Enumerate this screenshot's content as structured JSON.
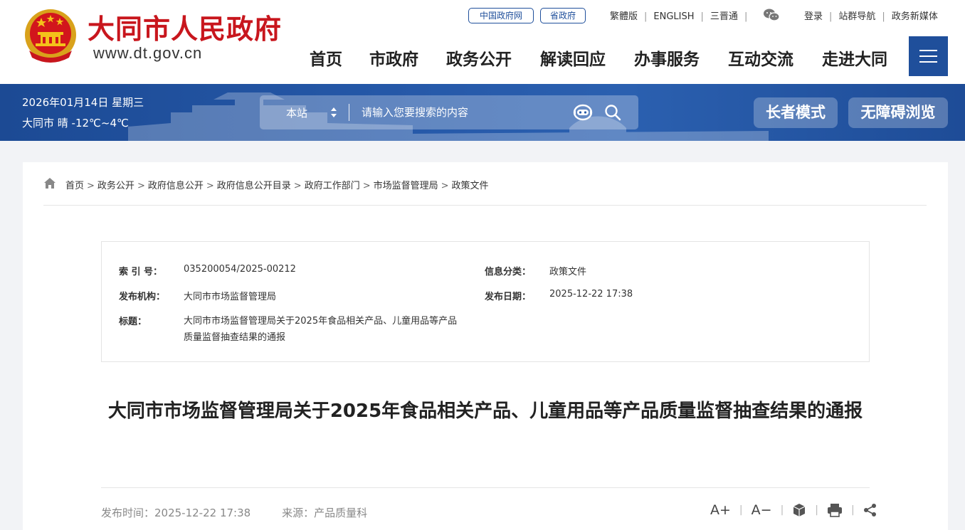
{
  "header": {
    "site_title": "大同市人民政府",
    "site_url": "www.dt.gov.cn",
    "pills": [
      "中国政府网",
      "省政府"
    ],
    "links": [
      "繁體版",
      "ENGLISH",
      "三晋通"
    ],
    "user_links": [
      "登录",
      "站群导航",
      "政务新媒体"
    ],
    "nav": [
      "首页",
      "市政府",
      "政务公开",
      "解读回应",
      "办事服务",
      "互动交流",
      "走进大同"
    ],
    "brand_color": "#c8161d",
    "accent_color": "#1f4f9b"
  },
  "banner": {
    "date": "2026年01月14日 星期三",
    "weather": "大同市 晴 -12℃~4℃",
    "search_scope": "本站",
    "search_placeholder": "请输入您要搜索的内容",
    "elder_mode": "长者模式",
    "accessible": "无障碍浏览"
  },
  "breadcrumb": [
    "首页",
    "政务公开",
    "政府信息公开",
    "政府信息公开目录",
    "政府工作部门",
    "市场监督管理局",
    "政策文件"
  ],
  "meta": {
    "index_label": "索 引 号：",
    "index_value": "035200054/2025-00212",
    "category_label": "信息分类：",
    "category_value": "政策文件",
    "publisher_label": "发布机构：",
    "publisher_value": "大同市市场监督管理局",
    "date_label": "发布日期：",
    "date_value": "2025-12-22 17:38",
    "title_label": "标题：",
    "title_value": "大同市市场监督管理局关于2025年食品相关产品、儿童用品等产品质量监督抽查结果的通报"
  },
  "article": {
    "title": "大同市市场监督管理局关于2025年食品相关产品、儿童用品等产品质量监督抽查结果的通报",
    "pub_time": "发布时间：2025-12-22 17:38",
    "source": "来源：产品质量科",
    "font_increase": "A+",
    "font_decrease": "A−"
  }
}
